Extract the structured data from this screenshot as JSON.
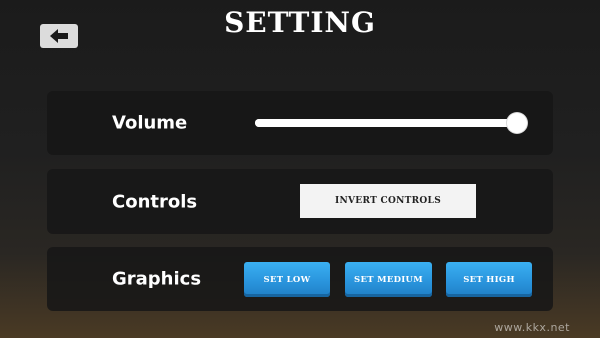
{
  "header": {
    "title": "SETTING",
    "back_icon": "arrow-left-icon"
  },
  "volume": {
    "label": "Volume",
    "level": 1.0
  },
  "controls": {
    "label": "Controls",
    "button_label": "INVERT CONTROLS"
  },
  "graphics": {
    "label": "Graphics",
    "buttons": [
      "SET LOW",
      "SET MEDIUM",
      "SET HIGH"
    ]
  },
  "watermark": "www.kkx.net",
  "colors": {
    "button_blue": "#2a95dd",
    "panel_bg": "#161616",
    "text": "#ffffff"
  }
}
